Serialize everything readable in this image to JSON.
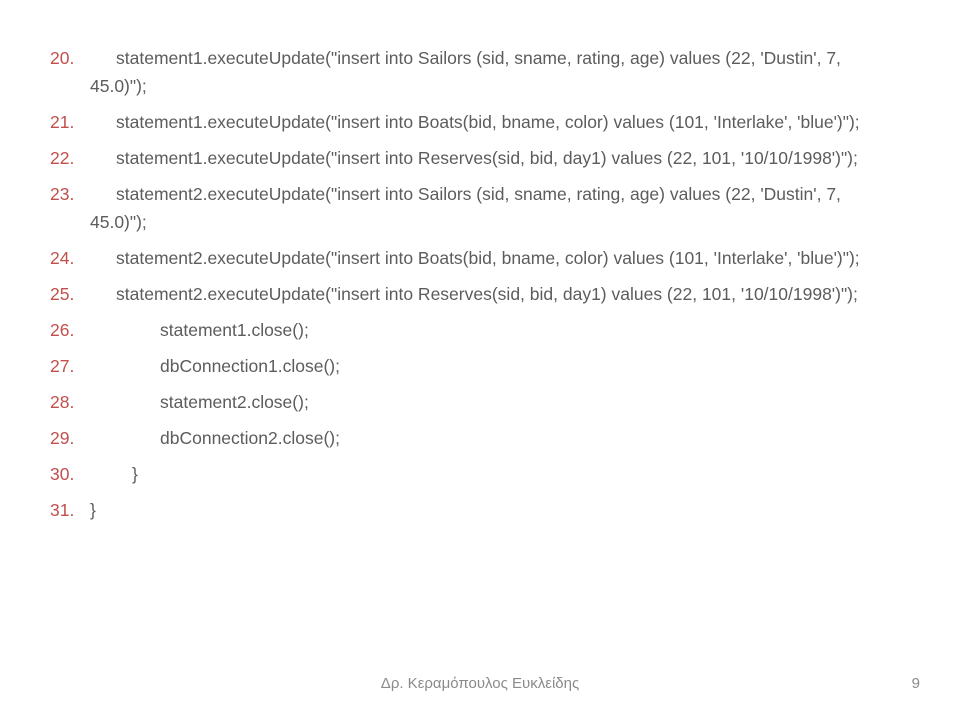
{
  "lines": [
    {
      "n": "20.",
      "pad": "indent1",
      "text": "statement1.executeUpdate(\"insert into Sailors (sid, sname, rating, age) values (22, 'Dustin', 7, 45.0)\");"
    },
    {
      "n": "21.",
      "pad": "indent1",
      "text": "statement1.executeUpdate(\"insert into Boats(bid, bname, color) values (101, 'Interlake', 'blue')\");"
    },
    {
      "n": "22.",
      "pad": "indent1",
      "text": "statement1.executeUpdate(\"insert into Reserves(sid, bid, day1) values (22, 101, '10/10/1998')\");"
    },
    {
      "n": "23.",
      "pad": "indent1",
      "text": "statement2.executeUpdate(\"insert into Sailors (sid, sname, rating, age) values (22, 'Dustin', 7, 45.0)\");"
    },
    {
      "n": "24.",
      "pad": "indent1",
      "text": "statement2.executeUpdate(\"insert into Boats(bid, bname, color) values (101, 'Interlake', 'blue')\");"
    },
    {
      "n": "25.",
      "pad": "indent1",
      "text": "statement2.executeUpdate(\"insert into Reserves(sid, bid, day1) values (22, 101, '10/10/1998')\");"
    },
    {
      "n": "26.",
      "pad": "indent2",
      "text": "statement1.close();"
    },
    {
      "n": "27.",
      "pad": "indent2",
      "text": "dbConnection1.close();"
    },
    {
      "n": "28.",
      "pad": "indent2",
      "text": "statement2.close();"
    },
    {
      "n": "29.",
      "pad": "indent2",
      "text": "dbConnection2.close();"
    },
    {
      "n": "30.",
      "pad": "indent3",
      "text": "}"
    },
    {
      "n": "31.",
      "pad": "",
      "text": "}"
    }
  ],
  "footer": "Δρ. Κεραμόπουλος Ευκλείδης",
  "page": "9"
}
